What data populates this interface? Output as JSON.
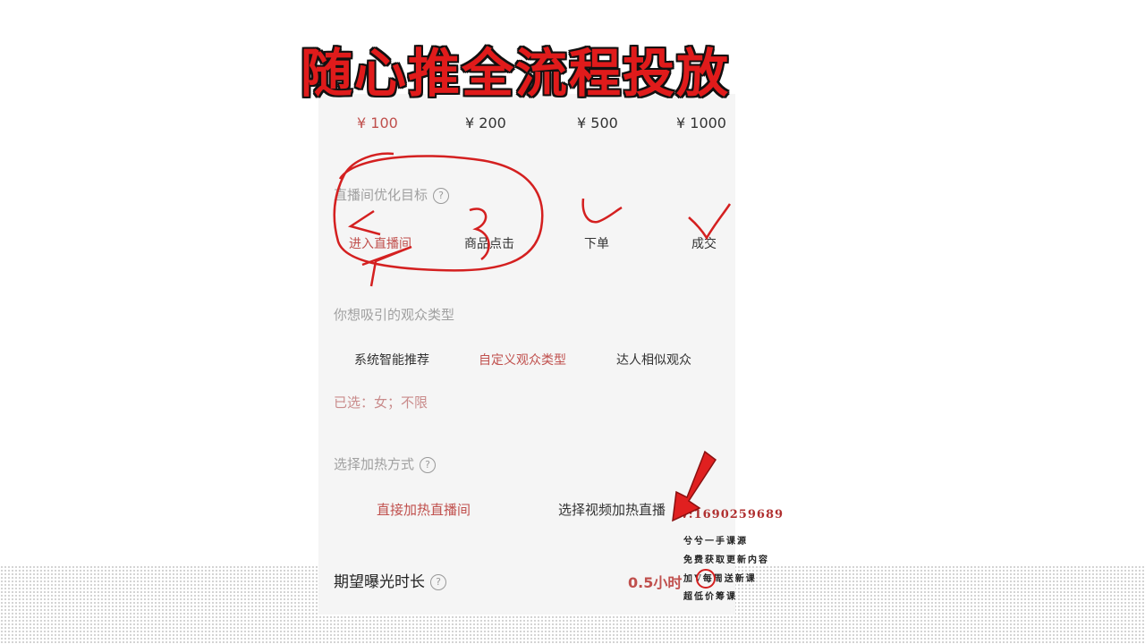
{
  "title": "随心推全流程投放",
  "prices": [
    "¥ 100",
    "¥ 200",
    "¥ 500",
    "¥ 1000"
  ],
  "optimize": {
    "label": "直播间优化目标",
    "options": [
      "进入直播间",
      "商品点击",
      "下单",
      "成交"
    ]
  },
  "audience": {
    "label": "你想吸引的观众类型",
    "options": [
      "系统智能推荐",
      "自定义观众类型",
      "达人相似观众"
    ],
    "selected": "已选：女；不限"
  },
  "boost": {
    "label": "选择加热方式",
    "options": [
      "直接加热直播间",
      "选择视频加热直播"
    ]
  },
  "duration": {
    "label": "期望曝光时长",
    "value": "0.5小时"
  },
  "watermark": {
    "contact": "V:1690259689",
    "lines": [
      "兮兮一手课源",
      "免费获取更新内容",
      "加V每周送新课",
      "超低价筹课"
    ]
  },
  "colors": {
    "accent": "#c0504d",
    "title": "#e01b1b",
    "annotation": "#d42020"
  }
}
